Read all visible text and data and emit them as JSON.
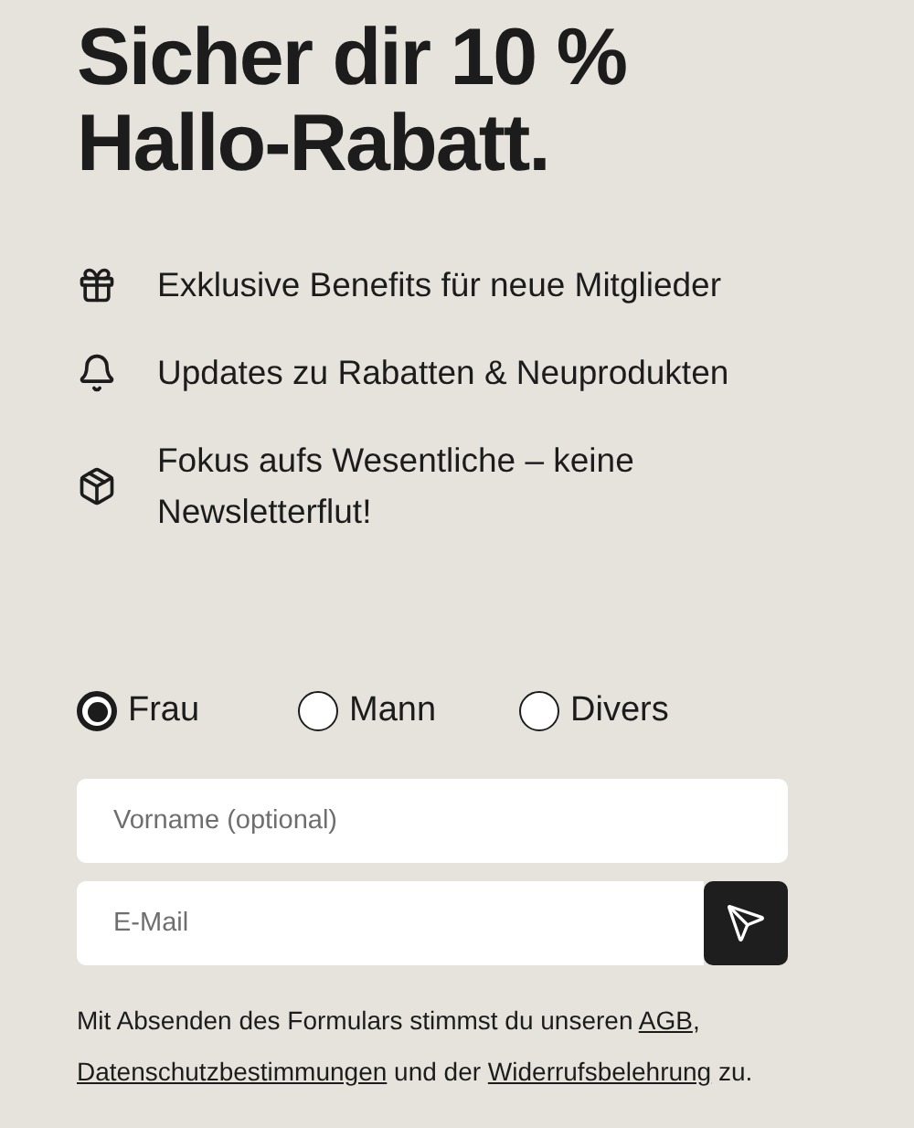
{
  "headline": "Sicher dir 10 % Hallo-Rabatt.",
  "benefits": [
    {
      "kind": "gift",
      "text": "Exklusive Benefits für neue Mitglieder"
    },
    {
      "kind": "bell",
      "text": "Updates zu Rabatten & Neuprodukten"
    },
    {
      "kind": "box",
      "text": "Fokus aufs Wesentliche – keine Newsletterflut!"
    }
  ],
  "salutation": [
    {
      "label": "Frau",
      "selected": true
    },
    {
      "label": "Mann",
      "selected": false
    },
    {
      "label": "Divers",
      "selected": false
    }
  ],
  "fields": [
    {
      "kind": "text",
      "placeholder": "Vorname (optional)"
    },
    {
      "kind": "email",
      "placeholder": "E-Mail"
    }
  ],
  "legal": [
    {
      "kind": "text",
      "text": "Mit Absenden des Formulars stimmst du unseren "
    },
    {
      "kind": "link",
      "text": "AGB"
    },
    {
      "kind": "text",
      "text": ", "
    },
    {
      "kind": "link",
      "text": "Datenschutzbestimmungen"
    },
    {
      "kind": "text",
      "text": " und der "
    },
    {
      "kind": "link",
      "text": "Widerrufsbelehrung"
    },
    {
      "kind": "text",
      "text": " zu."
    }
  ]
}
